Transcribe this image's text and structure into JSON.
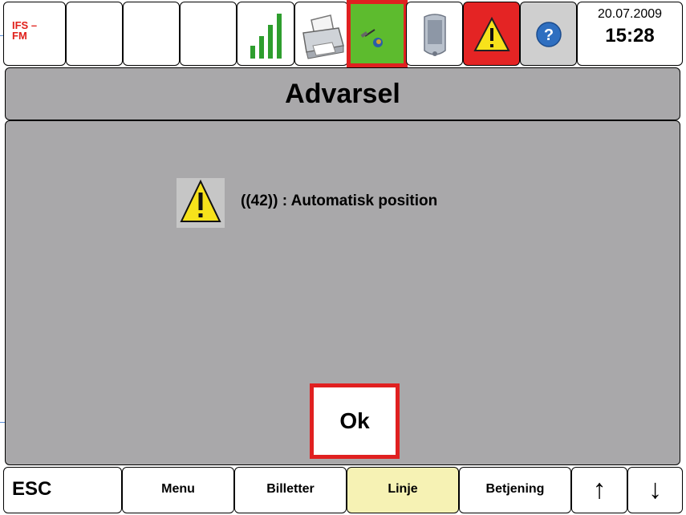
{
  "status": {
    "ifs_label": "IFS –\nFM",
    "date": "20.07.2009",
    "time": "15:28",
    "icons": [
      "signal-bars-icon",
      "printer-icon",
      "gps-satellite-icon",
      "device-icon",
      "warning-icon",
      "help-icon"
    ],
    "colors": {
      "gps_bg": "#5dbb2e",
      "warning_bg": "#e42424",
      "help_bg": "#c8c8c8",
      "highlight": "#e02020"
    }
  },
  "dialog": {
    "title": "Advarsel",
    "message": "((42)) : Automatisk position",
    "ok_label": "Ok"
  },
  "bottom": {
    "esc_label": "ESC",
    "menu_label": "Menu",
    "billetter_label": "Billetter",
    "linje_label": "Linje",
    "betjening_label": "Betjening",
    "up_label": "↑",
    "down_label": "↓"
  }
}
